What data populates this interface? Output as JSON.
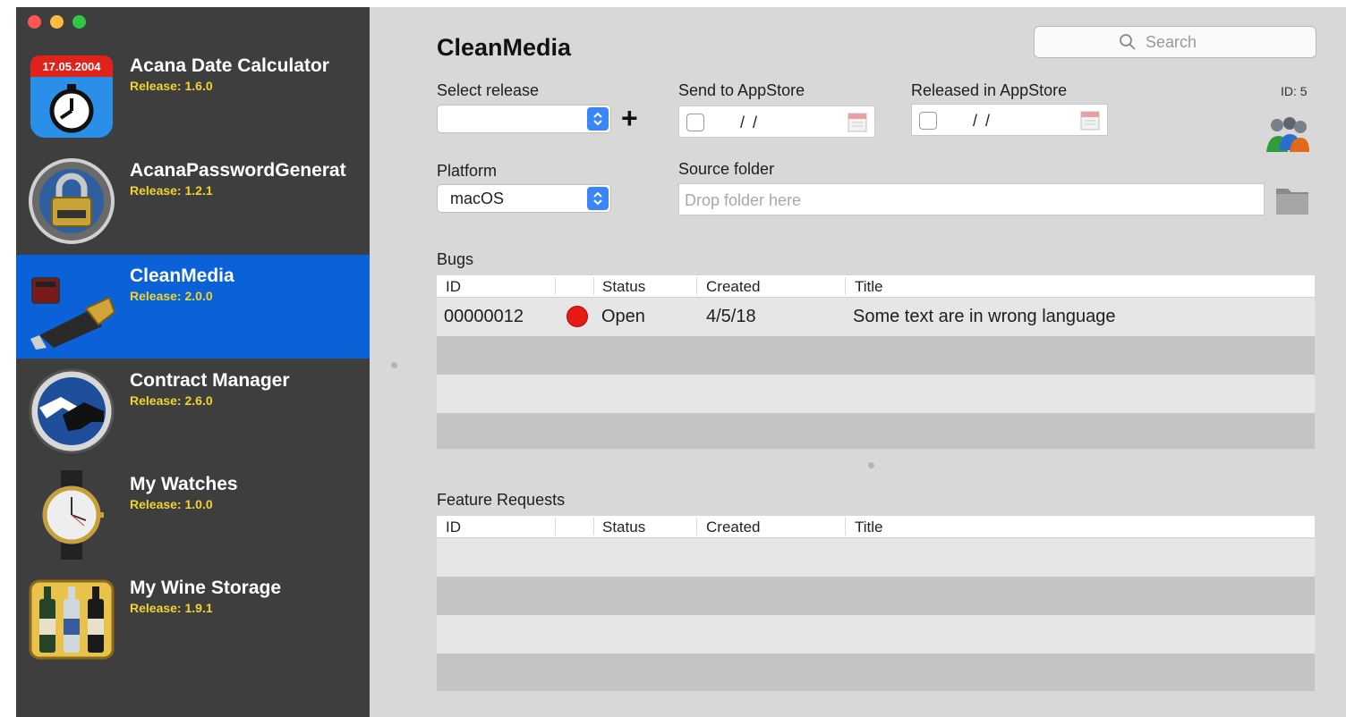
{
  "window": {
    "controls": [
      "close",
      "minimize",
      "zoom"
    ]
  },
  "sidebar": {
    "apps": [
      {
        "name": "Acana Date Calculator",
        "release": "Release: 1.6.0",
        "icon": "stopwatch-calendar-icon",
        "icon_text": "17.05.2004"
      },
      {
        "name": "AcanaPasswordGenerat",
        "release": "Release: 1.2.1",
        "icon": "padlock-icon"
      },
      {
        "name": "CleanMedia",
        "release": "Release: 2.0.0",
        "icon": "usb-drive-icon",
        "selected": true
      },
      {
        "name": "Contract Manager",
        "release": "Release: 2.6.0",
        "icon": "handshake-icon"
      },
      {
        "name": "My Watches",
        "release": "Release: 1.0.0",
        "icon": "watch-icon"
      },
      {
        "name": "My Wine Storage",
        "release": "Release: 1.9.1",
        "icon": "wine-bottles-icon"
      }
    ]
  },
  "main": {
    "title": "CleanMedia",
    "search": {
      "placeholder": "Search"
    },
    "id_label": "ID: 5",
    "select_release": {
      "label": "Select release",
      "value": "",
      "add_label": "+"
    },
    "send_to_appstore": {
      "label": "Send to AppStore",
      "value": "/   /"
    },
    "released_in_appstore": {
      "label": "Released in AppStore",
      "value": "/   /"
    },
    "platform": {
      "label": "Platform",
      "value": "macOS"
    },
    "source_folder": {
      "label": "Source folder",
      "placeholder": "Drop folder here"
    },
    "bugs": {
      "label": "Bugs",
      "columns": [
        "ID",
        "",
        "Status",
        "Created",
        "Title"
      ],
      "rows": [
        {
          "id": "00000012",
          "status": "Open",
          "status_color": "#e61b14",
          "created": "4/5/18",
          "title": "Some text are in wrong language"
        }
      ]
    },
    "feature_requests": {
      "label": "Feature Requests",
      "columns": [
        "ID",
        "",
        "Status",
        "Created",
        "Title"
      ],
      "rows": []
    }
  },
  "colors": {
    "sidebar_bg": "#3e3e3e",
    "selection": "#0b62d8",
    "release_text": "#f0d32c",
    "main_bg": "#d8d8d8"
  }
}
